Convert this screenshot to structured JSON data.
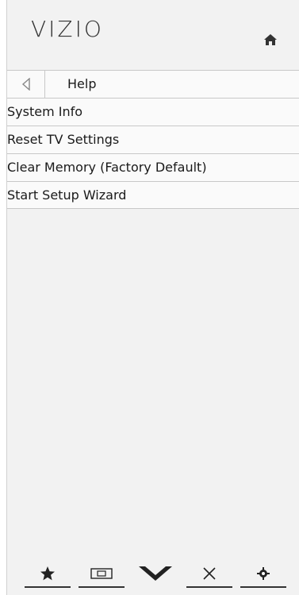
{
  "brand": {
    "logo_text": "VIZIO"
  },
  "header": {
    "title": "Help"
  },
  "menu_items": [
    {
      "label": "System Info"
    },
    {
      "label": "Reset TV Settings"
    },
    {
      "label": "Clear Memory (Factory Default)"
    },
    {
      "label": "Start Setup Wizard"
    }
  ],
  "bottom_bar": [
    {
      "icon": "star-icon"
    },
    {
      "icon": "input-icon"
    },
    {
      "icon": "vizio-v-icon"
    },
    {
      "icon": "close-icon"
    },
    {
      "icon": "gear-icon"
    }
  ],
  "colors": {
    "panel_bg": "#f2f2f2",
    "row_bg": "#fafafa",
    "divider": "#c8c8c8",
    "text": "#1a1a1a"
  }
}
